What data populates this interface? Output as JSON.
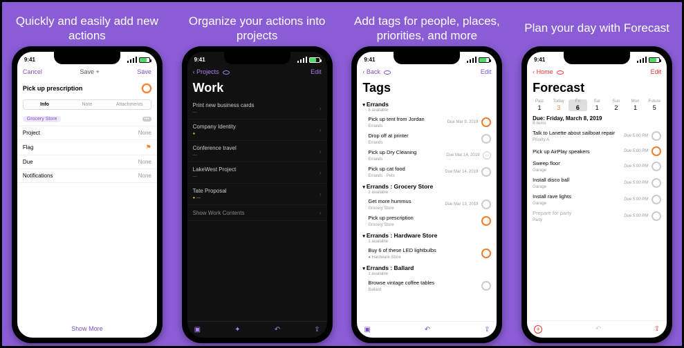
{
  "captions": {
    "p1": "Quickly and easily add new actions",
    "p2": "Organize your actions into projects",
    "p3": "Add tags for people, places, priorities, and more",
    "p4": "Plan your day with Forecast"
  },
  "status": {
    "time": "9:41"
  },
  "p1": {
    "cancel": "Cancel",
    "saveplus": "Save +",
    "save": "Save",
    "task": "Pick up prescription",
    "seg_info": "Info",
    "seg_note": "Note",
    "seg_att": "Attachments",
    "tag": "Grocery Store",
    "project_l": "Project",
    "project_v": "None",
    "flag_l": "Flag",
    "due_l": "Due",
    "due_v": "None",
    "notif_l": "Notifications",
    "notif_v": "None",
    "showmore": "Show More"
  },
  "p2": {
    "back": "Projects",
    "edit": "Edit",
    "title": "Work",
    "items": [
      "Print new business cards",
      "Company Identity",
      "Conference travel",
      "LakeWest Project",
      "Tate Proposal",
      "Show Work Contents"
    ]
  },
  "p3": {
    "back": "Back",
    "edit": "Edit",
    "title": "Tags",
    "s1": "Errands",
    "s1sub": "8 available",
    "r1": {
      "t": "Pick up tent from Jordan",
      "m": "Errands",
      "d": "Due Mar 9, 2019"
    },
    "r2": {
      "t": "Drop off at printer",
      "m": "Errands"
    },
    "r3": {
      "t": "Pick up Dry Cleaning",
      "m": "Errands",
      "d": "Due Mar 14, 2019"
    },
    "r4": {
      "t": "Pick up cat food",
      "m": "Errands · Pets",
      "d": "Due Mar 14, 2019"
    },
    "s2": "Errands : Grocery Store",
    "s2sub": "2 available",
    "r5": {
      "t": "Get more hummus",
      "m": "Grocery Store",
      "d": "Due Mar 13, 2019"
    },
    "r6": {
      "t": "Pick up prescription",
      "m": "Grocery Store"
    },
    "s3": "Errands : Hardware Store",
    "s3sub": "1 available",
    "r7": {
      "t": "Buy 6 of these LED lightbulbs",
      "m": "● Hardware Store"
    },
    "s4": "Errands : Ballard",
    "s4sub": "1 available",
    "r8": {
      "t": "Browse vintage coffee tables",
      "m": "Ballard"
    }
  },
  "p4": {
    "back": "Home",
    "edit": "Edit",
    "title": "Forecast",
    "days": [
      "Past",
      "Today",
      "Fri",
      "Sat",
      "Sun",
      "Mon",
      "Future"
    ],
    "nums": [
      "1",
      "3",
      "6",
      "1",
      "2",
      "1",
      "5"
    ],
    "header": "Due: Friday, March 8, 2019",
    "hsub": "6 items",
    "r1": {
      "t": "Talk to Lanette about sailboat repair",
      "m": "Priority A",
      "d": "Due 5:00 PM"
    },
    "r2": {
      "t": "Pick up AirPlay speakers",
      "d": "Due 5:00 PM"
    },
    "r3": {
      "t": "Sweep floor",
      "m": "Garage",
      "d": "Due 5:00 PM"
    },
    "r4": {
      "t": "Install disco ball",
      "m": "Garage",
      "d": "Due 5:00 PM"
    },
    "r5": {
      "t": "Install rave lights",
      "m": "Garage",
      "d": "Due 5:00 PM"
    },
    "r6": {
      "t": "Prepare for party",
      "m": "Party",
      "d": "Due 5:00 PM"
    }
  }
}
